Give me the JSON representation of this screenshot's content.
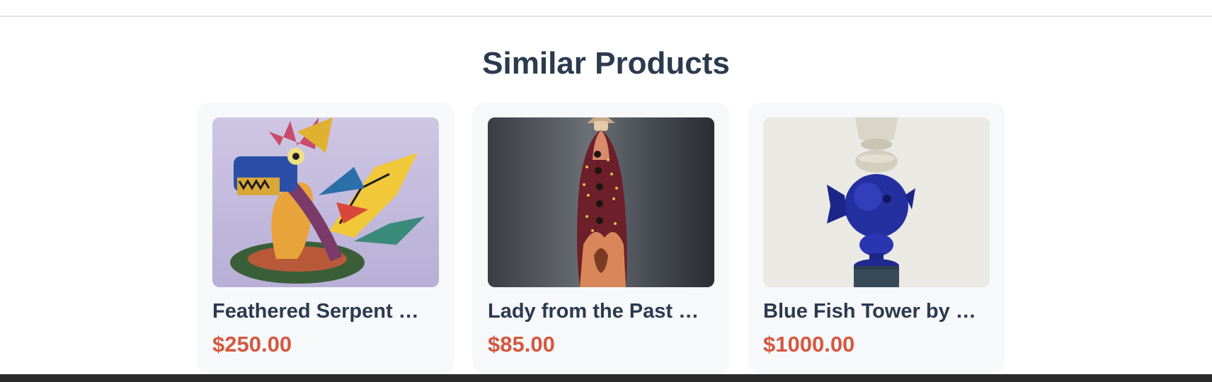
{
  "section": {
    "title": "Similar Products"
  },
  "products": [
    {
      "title": "Feathered Serpent Alebrije",
      "display_title": "Feathered Serpent …",
      "price": "$250.00",
      "image_icon": "feathered-serpent-figurine-image"
    },
    {
      "title": "Lady from the Past Ornament",
      "display_title": "Lady from the Past …",
      "price": "$85.00",
      "image_icon": "lady-ornament-image"
    },
    {
      "title": "Blue Fish Tower by Artist",
      "display_title": "Blue Fish Tower by …",
      "price": "$1000.00",
      "image_icon": "blue-fish-tower-image"
    }
  ],
  "colors": {
    "title": "#2c3a4e",
    "price": "#d4583f",
    "card_bg": "#f6f8fa",
    "footer": "#2a2a2a"
  }
}
